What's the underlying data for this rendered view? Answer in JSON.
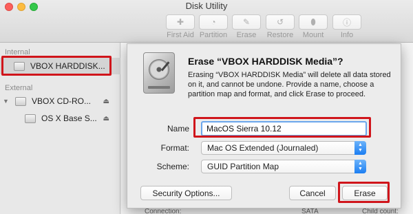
{
  "window": {
    "title": "Disk Utility"
  },
  "toolbar": {
    "buttons": [
      {
        "label": "First Aid",
        "icon": "first-aid-icon"
      },
      {
        "label": "Partition",
        "icon": "partition-icon"
      },
      {
        "label": "Erase",
        "icon": "erase-icon"
      },
      {
        "label": "Restore",
        "icon": "restore-icon"
      },
      {
        "label": "Mount",
        "icon": "mount-icon"
      },
      {
        "label": "Info",
        "icon": "info-icon"
      }
    ]
  },
  "sidebar": {
    "internal_heading": "Internal",
    "external_heading": "External",
    "items": [
      {
        "label": "VBOX HARDDISK...",
        "selected": true
      },
      {
        "label": "VBOX CD-RO...",
        "eject": "⏏"
      },
      {
        "label": "OS X Base S...",
        "eject": "⏏"
      }
    ]
  },
  "background": {
    "connection_label": "Connection:",
    "sata": "SATA",
    "child_count": "Child count:"
  },
  "sheet": {
    "title": "Erase “VBOX HARDDISK Media”?",
    "description": "Erasing “VBOX HARDDISK Media” will delete all data stored on it, and cannot be undone. Provide a name, choose a partition map and format, and click Erase to proceed.",
    "name_label": "Name",
    "name_value": "MacOS Sierra 10.12",
    "format_label": "Format:",
    "format_value": "Mac OS Extended (Journaled)",
    "scheme_label": "Scheme:",
    "scheme_value": "GUID Partition Map",
    "security_button": "Security Options...",
    "cancel_button": "Cancel",
    "erase_button": "Erase"
  },
  "colors": {
    "highlight": "#d0151b",
    "accent": "#1c7ef2"
  }
}
